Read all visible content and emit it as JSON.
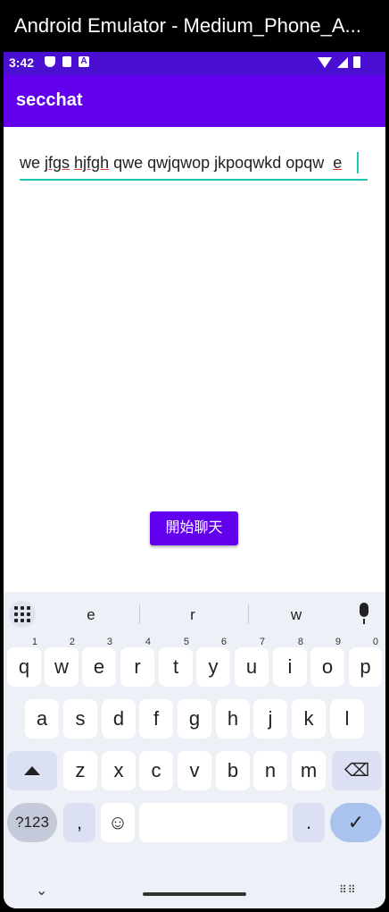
{
  "window": {
    "title": "Android Emulator - Medium_Phone_A..."
  },
  "status_bar": {
    "time": "3:42",
    "icons": [
      "shield-icon",
      "sd-card-icon",
      "a-icon",
      "wifi-icon",
      "signal-icon",
      "battery-icon"
    ]
  },
  "app_bar": {
    "title": "secchat"
  },
  "input": {
    "value_prefix": "we ",
    "value_misspelled_1": "jfgs",
    "value_gap": " ",
    "value_misspelled_2": "hjfgh",
    "value_rest": " qwe qwjqwop jkpoqwkd opqw  ",
    "value_last": "e"
  },
  "button": {
    "label": "開始聊天"
  },
  "keyboard": {
    "suggestions": [
      "e",
      "r",
      "w"
    ],
    "row1": [
      {
        "key": "q",
        "hint": "1"
      },
      {
        "key": "w",
        "hint": "2"
      },
      {
        "key": "e",
        "hint": "3"
      },
      {
        "key": "r",
        "hint": "4"
      },
      {
        "key": "t",
        "hint": "5"
      },
      {
        "key": "y",
        "hint": "6"
      },
      {
        "key": "u",
        "hint": "7"
      },
      {
        "key": "i",
        "hint": "8"
      },
      {
        "key": "o",
        "hint": "9"
      },
      {
        "key": "p",
        "hint": "0"
      }
    ],
    "row2": [
      "a",
      "s",
      "d",
      "f",
      "g",
      "h",
      "j",
      "k",
      "l"
    ],
    "row3": [
      "z",
      "x",
      "c",
      "v",
      "b",
      "n",
      "m"
    ],
    "bottom": {
      "symbols": "?123",
      "comma": ",",
      "period": "."
    }
  },
  "colors": {
    "app_bar": "#6200ee",
    "status_bar": "#4a0fd0",
    "accent": "#1fc7b0"
  }
}
